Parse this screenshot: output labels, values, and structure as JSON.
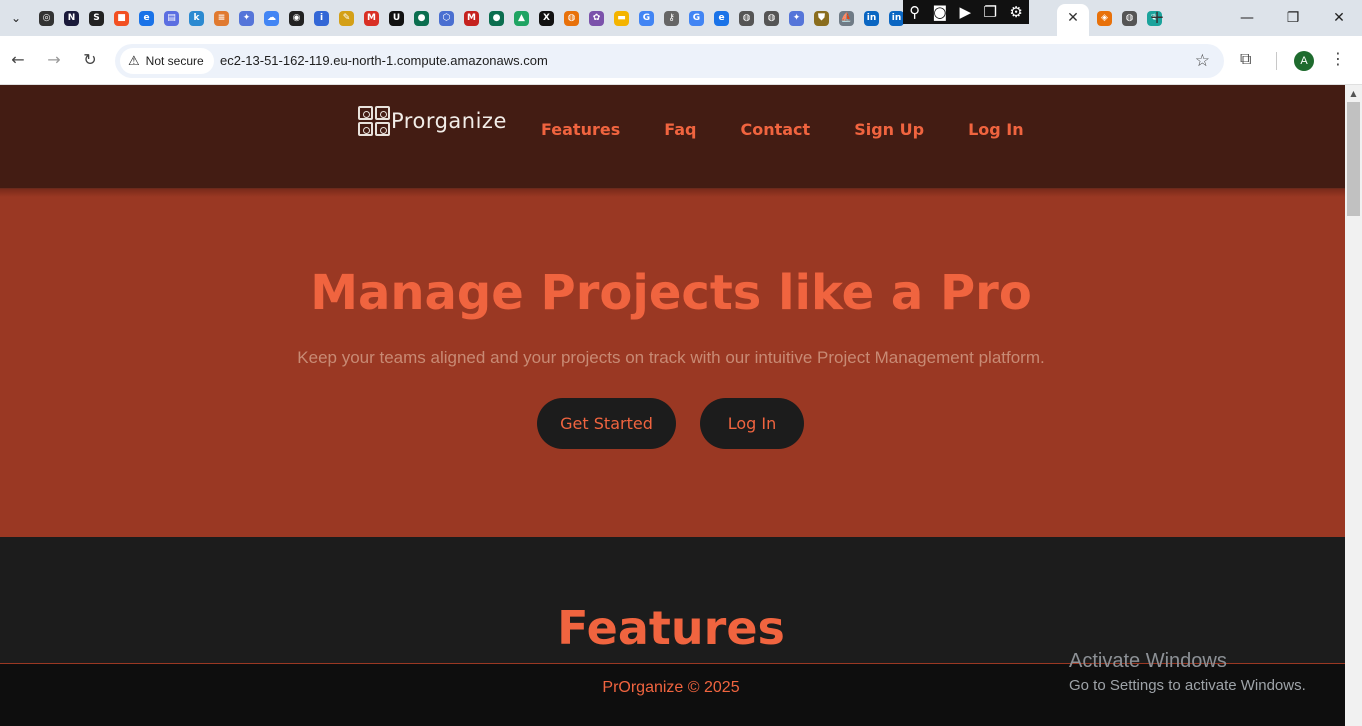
{
  "browser": {
    "favicon_tabs": [
      {
        "icon": "openai-icon",
        "color": "#333333",
        "glyph": "◎"
      },
      {
        "icon": "n-icon",
        "color": "#1a1a3a",
        "glyph": "N"
      },
      {
        "icon": "svg-icon",
        "color": "#222222",
        "glyph": "S"
      },
      {
        "icon": "microsoft-icon",
        "color": "#f25022",
        "glyph": "■"
      },
      {
        "icon": "edge-icon",
        "color": "#1a73e8",
        "glyph": "e"
      },
      {
        "icon": "printer-icon",
        "color": "#5b6ee1",
        "glyph": "▤"
      },
      {
        "icon": "k-icon",
        "color": "#2b8ad1",
        "glyph": "k"
      },
      {
        "icon": "stack-icon",
        "color": "#e07a30",
        "glyph": "≡"
      },
      {
        "icon": "gift-icon",
        "color": "#5575d9",
        "glyph": "✦"
      },
      {
        "icon": "cloud-icon",
        "color": "#4285f4",
        "glyph": "☁"
      },
      {
        "icon": "aperture-icon",
        "color": "#222222",
        "glyph": "◉"
      },
      {
        "icon": "info-icon",
        "color": "#3367d6",
        "glyph": "i"
      },
      {
        "icon": "pen-icon",
        "color": "#d4a017",
        "glyph": "✎"
      },
      {
        "icon": "gmail-icon",
        "color": "#d93025",
        "glyph": "M"
      },
      {
        "icon": "uh-icon",
        "color": "#111111",
        "glyph": "U"
      },
      {
        "icon": "toggle-icon",
        "color": "#0b6e4f",
        "glyph": "●"
      },
      {
        "icon": "hexagon-icon",
        "color": "#4a6fd1",
        "glyph": "⬡"
      },
      {
        "icon": "mail-icon",
        "color": "#c5221f",
        "glyph": "M"
      },
      {
        "icon": "toggle-icon",
        "color": "#0b6e4f",
        "glyph": "●"
      },
      {
        "icon": "drive-icon",
        "color": "#1fa463",
        "glyph": "▲"
      },
      {
        "icon": "x-icon",
        "color": "#111111",
        "glyph": "X"
      },
      {
        "icon": "globe-icon",
        "color": "#e8710a",
        "glyph": "◍"
      },
      {
        "icon": "apps-icon",
        "color": "#7b52ab",
        "glyph": "✿"
      },
      {
        "icon": "slides-icon",
        "color": "#f4b400",
        "glyph": "▬"
      },
      {
        "icon": "google-icon",
        "color": "#4285f4",
        "glyph": "G"
      },
      {
        "icon": "key-icon",
        "color": "#666666",
        "glyph": "⚷"
      },
      {
        "icon": "google-icon",
        "color": "#4285f4",
        "glyph": "G"
      },
      {
        "icon": "edge-icon",
        "color": "#1a73e8",
        "glyph": "e"
      },
      {
        "icon": "globe-icon",
        "color": "#555555",
        "glyph": "◍"
      },
      {
        "icon": "globe-icon",
        "color": "#555555",
        "glyph": "◍"
      },
      {
        "icon": "gift-icon",
        "color": "#5575d9",
        "glyph": "✦"
      },
      {
        "icon": "shield-icon",
        "color": "#8a6d1e",
        "glyph": "⛊"
      },
      {
        "icon": "ship-icon",
        "color": "#6f7b86",
        "glyph": "⛵"
      },
      {
        "icon": "linkedin-icon",
        "color": "#0a66c2",
        "glyph": "in"
      },
      {
        "icon": "linkedin-icon",
        "color": "#0a66c2",
        "glyph": "in"
      }
    ],
    "extra_tabs_after": [
      {
        "icon": "orange-app-icon",
        "color": "#e8710a",
        "glyph": "◈"
      },
      {
        "icon": "globe-icon",
        "color": "#555555",
        "glyph": "◍"
      },
      {
        "icon": "leaf-icon",
        "color": "#1ba39c",
        "glyph": "❦"
      }
    ],
    "security_label": "Not secure",
    "url": "ec2-13-51-162-119.eu-north-1.compute.amazonaws.com",
    "profile_initial": "A"
  },
  "site": {
    "logo_text": "Prorganize",
    "nav": [
      "Features",
      "Faq",
      "Contact",
      "Sign Up",
      "Log In"
    ],
    "hero": {
      "title": "Manage Projects like a Pro",
      "subtitle": "Keep your teams aligned and your projects on track with our intuitive Project Management platform.",
      "primary_button": "Get Started",
      "secondary_button": "Log In"
    },
    "features_title": "Features",
    "footer": "PrOrganize © 2025"
  },
  "windows": {
    "activate_title": "Activate Windows",
    "activate_sub": "Go to Settings to activate Windows."
  },
  "colors": {
    "header_bg": "#431c13",
    "hero_bg": "#9a3823",
    "accent": "#f0643f",
    "button_bg": "#1c1c1c",
    "features_bg": "#1c1c1c",
    "footer_bg": "#0e0e0e"
  }
}
